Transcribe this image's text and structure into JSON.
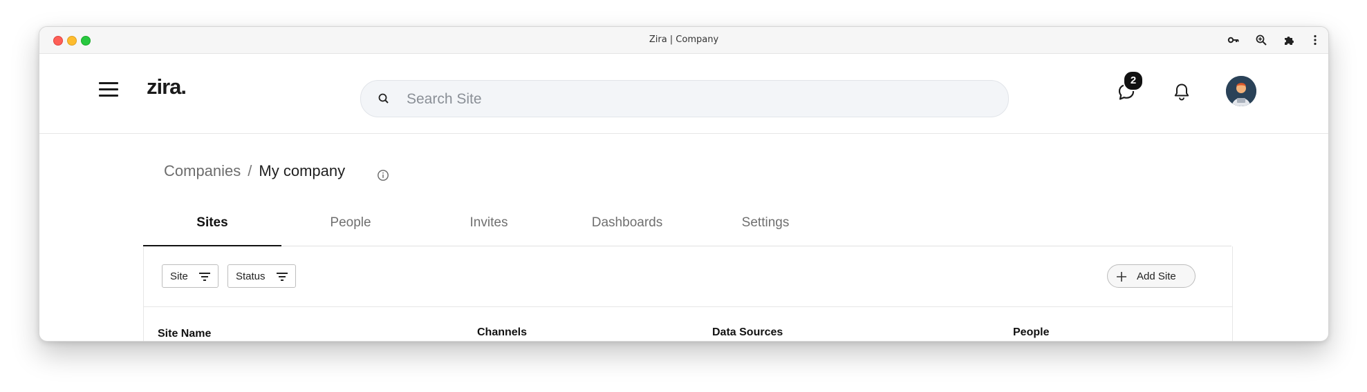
{
  "window": {
    "title": "Zira | Company"
  },
  "header": {
    "logo": "zira.",
    "search": {
      "placeholder": "Search Site",
      "value": ""
    },
    "messages_badge": "2"
  },
  "breadcrumb": {
    "parent": "Companies",
    "separator": "/",
    "current": "My company"
  },
  "tabs": [
    {
      "label": "Sites",
      "active": true
    },
    {
      "label": "People",
      "active": false
    },
    {
      "label": "Invites",
      "active": false
    },
    {
      "label": "Dashboards",
      "active": false
    },
    {
      "label": "Settings",
      "active": false
    }
  ],
  "filters": {
    "site_label": "Site",
    "status_label": "Status"
  },
  "actions": {
    "add_site_label": "Add Site"
  },
  "table": {
    "columns": [
      "Site Name",
      "Channels",
      "Data Sources",
      "People"
    ]
  },
  "icons": {
    "toolbar": [
      "key-icon",
      "zoom-icon",
      "extension-icon",
      "more-vertical-icon"
    ],
    "header": [
      "menu-icon",
      "search-icon",
      "chat-icon",
      "bell-icon",
      "avatar"
    ]
  }
}
